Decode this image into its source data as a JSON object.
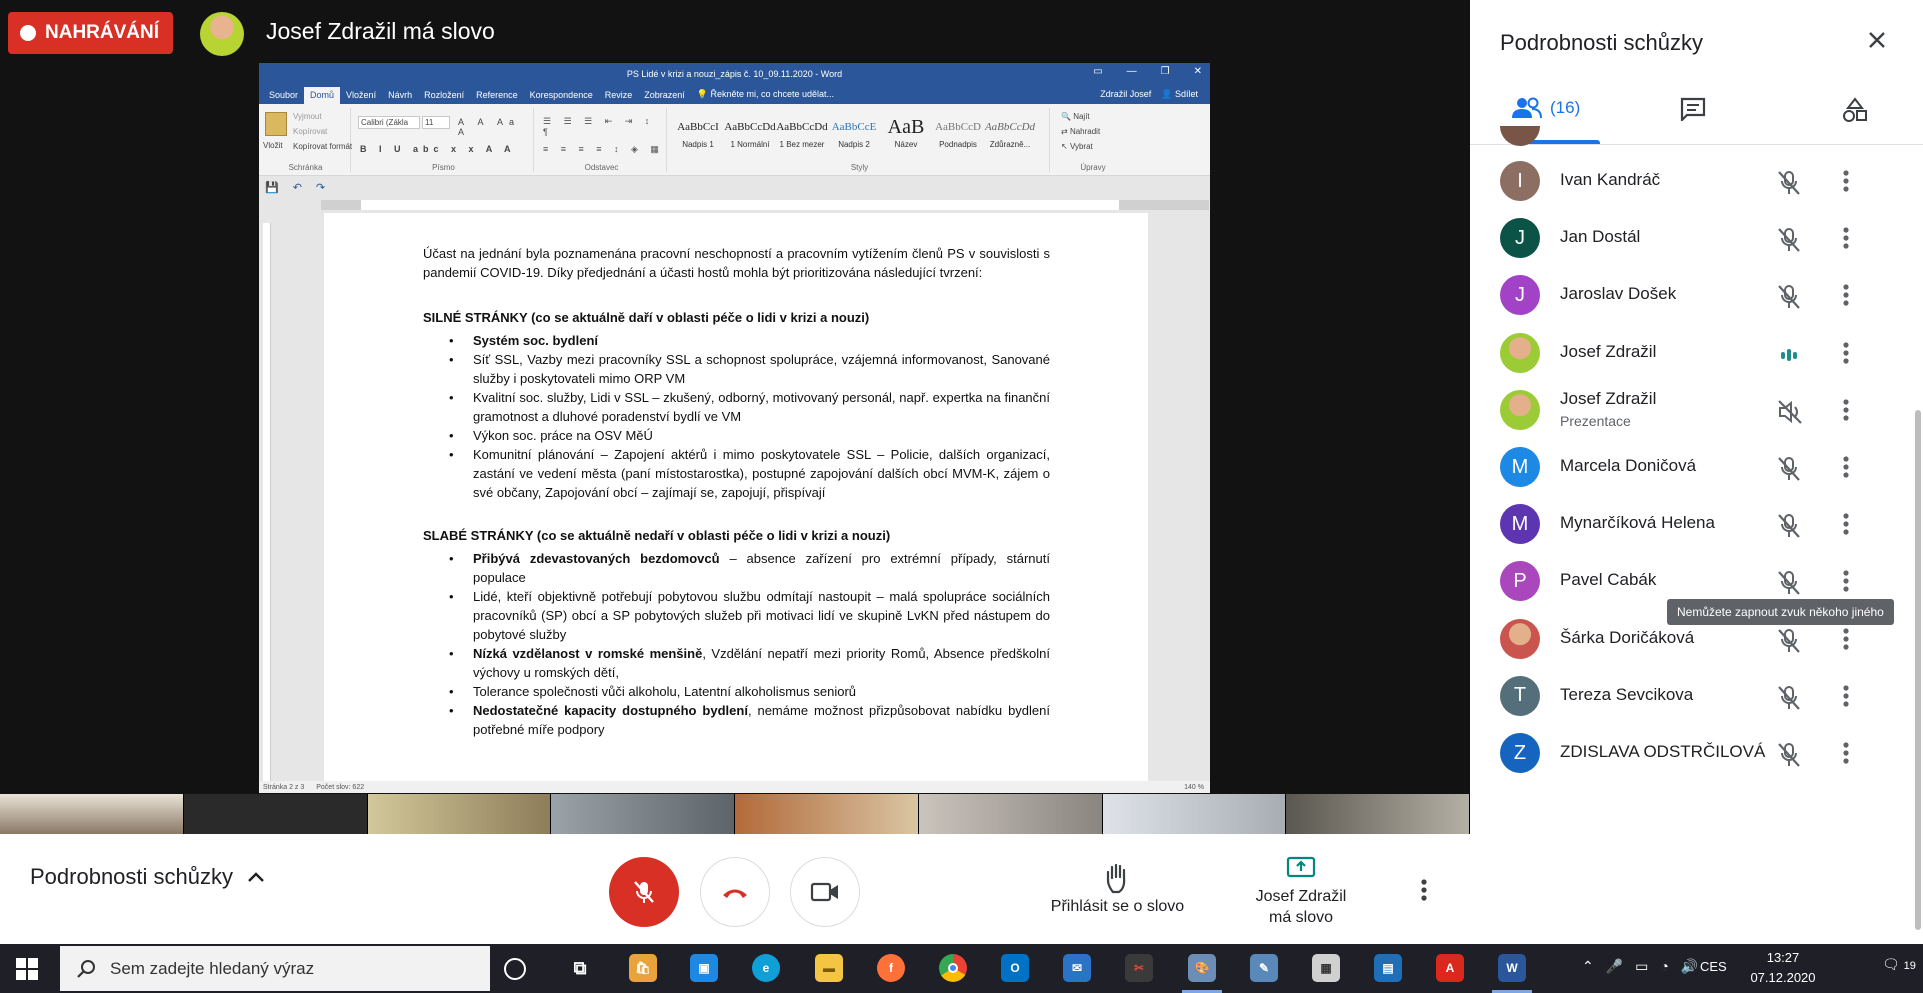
{
  "recording_label": "NAHRÁVÁNÍ",
  "speaker_title": "Josef Zdražil má slovo",
  "word": {
    "window_title": "PS Lidé v krizi a nouzi_zápis č. 10_09.11.2020 - Word",
    "tabs": [
      "Soubor",
      "Domů",
      "Vložení",
      "Návrh",
      "Rozložení",
      "Reference",
      "Korespondence",
      "Revize",
      "Zobrazení"
    ],
    "tell_me": "Řekněte mi, co chcete udělat...",
    "user": "Zdražil Josef",
    "share": "Sdílet",
    "ribbon": {
      "clipboard": {
        "label": "Schránka",
        "paste": "Vložit",
        "cut": "Vyjmout",
        "copy": "Kopírovat",
        "format": "Kopírovat formát"
      },
      "font": {
        "label": "Písmo",
        "name": "Calibri (Zákla",
        "size": "11"
      },
      "paragraph": {
        "label": "Odstavec"
      },
      "styles": {
        "label": "Styly",
        "items": [
          {
            "sample": "AaBbCcI",
            "name": "Nadpis 1"
          },
          {
            "sample": "AaBbCcDd",
            "name": "1 Normální"
          },
          {
            "sample": "AaBbCcDd",
            "name": "1 Bez mezer"
          },
          {
            "sample": "AaBbCcE",
            "name": "Nadpis 2"
          },
          {
            "sample": "AaB",
            "name": "Název"
          },
          {
            "sample": "AaBbCcD",
            "name": "Podnadpis"
          },
          {
            "sample": "AaBbCcDd",
            "name": "Zdůrazně..."
          }
        ]
      },
      "editing": {
        "label": "Úpravy",
        "find": "Najít",
        "replace": "Nahradit",
        "select": "Vybrat"
      }
    },
    "intro": "Účast na jednání byla poznamenána pracovní neschopností a pracovním vytížením členů PS v souvislosti s pandemií COVID-19. Díky předjednání a účasti hostů mohla být prioritizována následující tvrzení:",
    "strengths_heading": "SILNÉ STRÁNKY (co se aktuálně daří v oblasti péče o lidi v krizi a nouzi)",
    "strengths": [
      {
        "bold": "Systém soc. bydlení",
        "text": ""
      },
      {
        "bold": "",
        "text": "Síť SSL, Vazby mezi pracovníky SSL a schopnost spolupráce, vzájemná informovanost, Sanované služby i poskytovateli mimo ORP VM"
      },
      {
        "bold": "",
        "text": "Kvalitní soc. služby, Lidi v SSL – zkušený, odborný, motivovaný personál, např. expertka na finanční gramotnost a dluhové poradenství bydlí ve VM"
      },
      {
        "bold": "",
        "text": "Výkon soc. práce na OSV MěÚ"
      },
      {
        "bold": "",
        "text": "Komunitní plánování – Zapojení aktérů i mimo poskytovatele SSL – Policie, dalších organizací, zastání ve vedení města (paní místostarostka), postupné zapojování dalších obcí MVM-K, zájem o své občany, Zapojování obcí – zajímají se, zapojují, přispívají"
      }
    ],
    "weaknesses_heading": "SLABÉ STRÁNKY (co se aktuálně nedaří v oblasti péče o lidi v krizi a nouzi)",
    "weaknesses": [
      {
        "bold": "Přibývá zdevastovaných bezdomovců",
        "text": " – absence zařízení pro extrémní případy, stárnutí populace"
      },
      {
        "bold": "",
        "text": "Lidé, kteří objektivně potřebují pobytovou službu odmítají nastoupit – malá spolupráce sociálních pracovníků (SP) obcí a SP pobytových služeb při motivaci lidí ve skupině LvKN před nástupem do pobytové služby"
      },
      {
        "bold": "Nízká vzdělanost v romské menšině",
        "text": ", Vzdělání nepatří mezi priority Romů, Absence předškolní výchovy u romských dětí,"
      },
      {
        "bold": "",
        "text": "Tolerance společnosti vůči alkoholu, Latentní alkoholismus seniorů"
      },
      {
        "bold": "Nedostatečné kapacity dostupného bydlení",
        "text": ", nemáme možnost přizpůsobovat nabídku bydlení potřebné míře podpory"
      }
    ],
    "status_page": "Stránka 2 z 3",
    "status_words": "Počet slov: 622",
    "zoom": "140 %"
  },
  "controls": {
    "details_label": "Podrobnosti schůzky",
    "raise_hand": "Přihlásit se o slovo",
    "presenting_line1": "Josef Zdražil",
    "presenting_line2": "má slovo"
  },
  "panel": {
    "title": "Podrobnosti schůzky",
    "people_count": "(16)",
    "tooltip": "Nemůžete zapnout zvuk někoho jiného",
    "participants": [
      {
        "initial": "I",
        "name": "Ivan Kandráč",
        "color": "#8d6e63",
        "sub": ""
      },
      {
        "initial": "J",
        "name": "Jan Dostál",
        "color": "#0b5346",
        "sub": ""
      },
      {
        "initial": "J",
        "name": "Jaroslav Došek",
        "color": "#a142c7",
        "sub": ""
      },
      {
        "initial": "",
        "name": "Josef Zdražil",
        "color": "#9ccc35",
        "sub": ""
      },
      {
        "initial": "",
        "name": "Josef Zdražil",
        "color": "#9ccc35",
        "sub": "Prezentace"
      },
      {
        "initial": "M",
        "name": "Marcela Doničová",
        "color": "#1e88e5",
        "sub": ""
      },
      {
        "initial": "M",
        "name": "Mynarčíková Helena",
        "color": "#5e35b1",
        "sub": ""
      },
      {
        "initial": "P",
        "name": "Pavel Cabák",
        "color": "#ab47bc",
        "sub": ""
      },
      {
        "initial": "",
        "name": "Šárka Doričáková",
        "color": "#c9554e",
        "sub": ""
      },
      {
        "initial": "T",
        "name": "Tereza Sevcikova",
        "color": "#546e7a",
        "sub": ""
      },
      {
        "initial": "Z",
        "name": "ZDISLAVA ODSTRČILOVÁ",
        "color": "#1565c0",
        "sub": ""
      }
    ]
  },
  "taskbar": {
    "search_placeholder": "Sem zadejte hledaný výraz",
    "lang": "CES",
    "time": "13:27",
    "date": "07.12.2020",
    "notifications": "19"
  }
}
